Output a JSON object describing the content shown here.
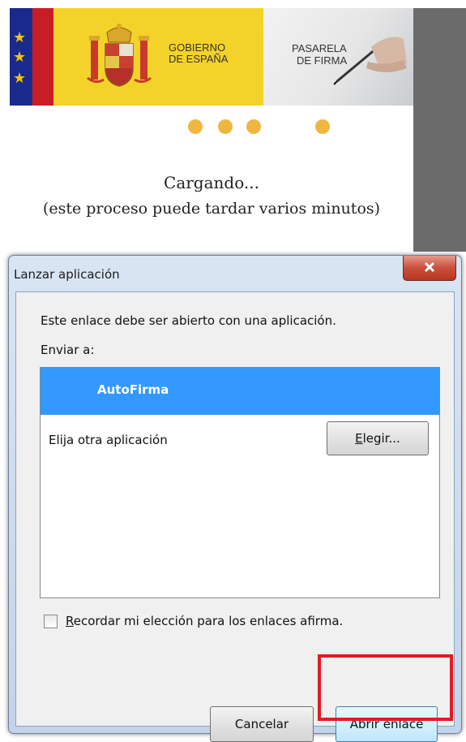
{
  "webpage": {
    "gov_line1": "GOBIERNO",
    "gov_line2": "DE ESPAÑA",
    "pasarela_line1": "PASARELA",
    "pasarela_line2": "DE FIRMA",
    "loading_title": "Cargando...",
    "loading_subtitle": "(este proceso puede tardar varios minutos)",
    "dot_color": "#f0b740"
  },
  "dialog": {
    "title": "Lanzar aplicación",
    "close_label": "x",
    "message": "Este enlace debe ser abierto con una aplicación.",
    "send_to_label": "Enviar a:",
    "selected_app": "AutoFirma",
    "other_app_label": "Elija otra aplicación",
    "choose_button": {
      "first": "E",
      "rest": "legir..."
    },
    "remember_label": {
      "first": "R",
      "rest": "ecordar mi elección para los enlaces afirma."
    },
    "remember_checked": false,
    "cancel_button": "Cancelar",
    "open_button": "Abrir enlace",
    "selection_color": "#3399ff",
    "highlight_color": "#e31b23"
  }
}
